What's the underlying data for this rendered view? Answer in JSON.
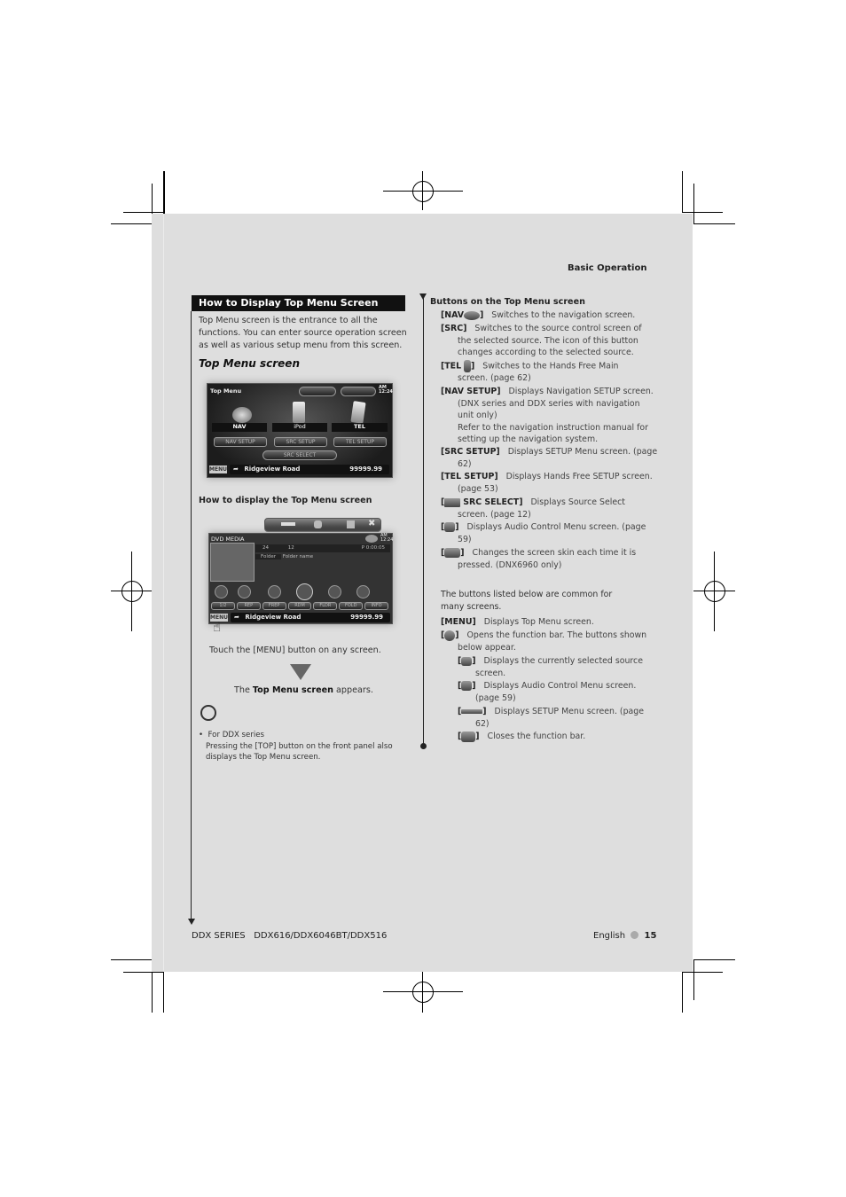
{
  "header": {
    "section": "Basic Operation"
  },
  "left": {
    "section_title": "How to Display Top Menu Screen",
    "intro": [
      "Top Menu screen is the entrance to all the",
      "functions. You can enter source operation screen",
      "as well as various setup menu from this screen."
    ],
    "subtitle": "Top Menu screen",
    "top_menu_screen": {
      "title": "Top Menu",
      "time_ampm": "AM",
      "time": "12:24",
      "buttons": [
        "NAV",
        "iPod",
        "TEL"
      ],
      "setup_buttons": [
        "NAV SETUP",
        "SRC SETUP",
        "TEL SETUP"
      ],
      "src_select": "SRC SELECT",
      "menu_key": "MENU",
      "road": "Ridgeview Road",
      "distance": "99999.99"
    },
    "how_to_title": "How to display the Top Menu screen",
    "dvd_screen": {
      "title": "DVD MEDIA",
      "time_ampm": "AM",
      "time": "12:24",
      "track_a": "24",
      "track_b": "12",
      "play_time": "P  0:00:05",
      "folder_label": "Folder",
      "folder_name": "Folder name",
      "function_keys": [
        "1/2",
        "REP",
        "FREP",
        "RDM",
        "FLDR",
        "FOLD",
        "INFO"
      ],
      "menu_key": "MENU",
      "road": "Ridgeview Road",
      "distance": "99999.99"
    },
    "instruction": "Touch the [MENU] button on any screen.",
    "result_prefix": "The ",
    "result_bold": "Top Menu screen",
    "result_suffix": " appears.",
    "note_bullet": "For DDX series",
    "note_lines": [
      "Pressing the [TOP] button on the front panel also",
      "displays the Top Menu screen."
    ]
  },
  "right": {
    "title": "Buttons on the Top Menu screen",
    "items": [
      {
        "key": "[NAV",
        "key_end": "]",
        "lines": [
          "Switches to the navigation screen."
        ],
        "icon": "nav-icon"
      },
      {
        "key": "[SRC]",
        "lines": [
          "Switches to the source control screen of",
          "the selected source. The icon of this button",
          "changes according to the selected source."
        ]
      },
      {
        "key": "[TEL",
        "key_end": "]",
        "lines": [
          "Switches to the Hands Free Main",
          "screen. (page 62)"
        ],
        "icon": "phone-icon"
      },
      {
        "key": "[NAV SETUP]",
        "lines": [
          "Displays Navigation SETUP screen.",
          "(DNX series and DDX series with navigation",
          "unit only)",
          "Refer to the navigation instruction manual for",
          "setting up the navigation system."
        ]
      },
      {
        "key": "[SRC SETUP]",
        "lines": [
          "Displays SETUP Menu screen. (page",
          "62)"
        ]
      },
      {
        "key": "[TEL SETUP]",
        "lines": [
          "Displays Hands Free SETUP screen.",
          "(page 53)"
        ]
      },
      {
        "key": "[",
        "key_mid": "SRC SELECT]",
        "lines": [
          "Displays Source Select",
          "screen. (page 12)"
        ],
        "icon": "source-select-icon"
      },
      {
        "key": "[",
        "key_end": "]",
        "lines": [
          "Displays Audio Control Menu screen. (page",
          "59)"
        ],
        "icon": "audio-control-icon"
      },
      {
        "key": "[",
        "key_end": "]",
        "lines": [
          "Changes the screen skin each time it is",
          "pressed. (DNX6960 only)"
        ],
        "icon": "skin-icon"
      }
    ],
    "common_intro": [
      "The buttons listed below are common for",
      "many screens."
    ],
    "common_items": [
      {
        "key": "[MENU]",
        "lines": [
          "Displays Top Menu screen."
        ]
      },
      {
        "key": "[",
        "key_end": "]",
        "lines": [
          "Opens the function bar. The buttons shown",
          "below appear."
        ],
        "icon": "function-bar-icon"
      }
    ],
    "sub_items": [
      {
        "key": "[",
        "key_end": "]",
        "lines": [
          "Displays the currently selected source",
          "screen."
        ],
        "icon": "source-screen-icon"
      },
      {
        "key": "[",
        "key_end": "]",
        "lines": [
          "Displays Audio Control Menu screen.",
          "(page 59)"
        ],
        "icon": "audio-control-icon"
      },
      {
        "key": "[",
        "key_end": "]",
        "lines": [
          "Displays SETUP Menu screen. (page",
          "62)"
        ],
        "icon": "wrench-icon"
      },
      {
        "key": "[",
        "key_end": "]",
        "lines": [
          "Closes the function bar."
        ],
        "icon": "close-icon"
      }
    ]
  },
  "footer": {
    "series": "DDX SERIES",
    "models": "DDX616/DDX6046BT/DDX516",
    "language": "English",
    "page": "15"
  }
}
